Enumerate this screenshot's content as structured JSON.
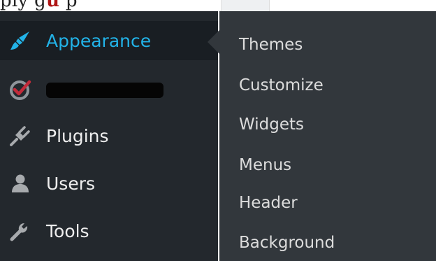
{
  "document": {
    "text_left": "ply g",
    "text_red_1": "u",
    "text_mid": "p",
    "text_red_2": "",
    "text_right": "p"
  },
  "sidebar": {
    "items": [
      {
        "label": "Appearance",
        "icon": "paintbrush-icon",
        "current": true
      },
      {
        "label": "",
        "icon": "plugin-badge-icon",
        "redacted": true
      },
      {
        "label": "Plugins",
        "icon": "plugin-plug-icon"
      },
      {
        "label": "Users",
        "icon": "user-icon"
      },
      {
        "label": "Tools",
        "icon": "wrench-icon"
      }
    ]
  },
  "submenu": {
    "items": [
      {
        "label": "Themes"
      },
      {
        "label": "Customize"
      },
      {
        "label": "Widgets"
      },
      {
        "label": "Menus"
      },
      {
        "label": "Header"
      },
      {
        "label": "Background"
      }
    ]
  },
  "colors": {
    "sidebar_bg": "#23282d",
    "current_bg": "#191e23",
    "flyout_bg": "#32373c",
    "accent": "#22b3e8",
    "badge_red": "#c22b3a"
  }
}
